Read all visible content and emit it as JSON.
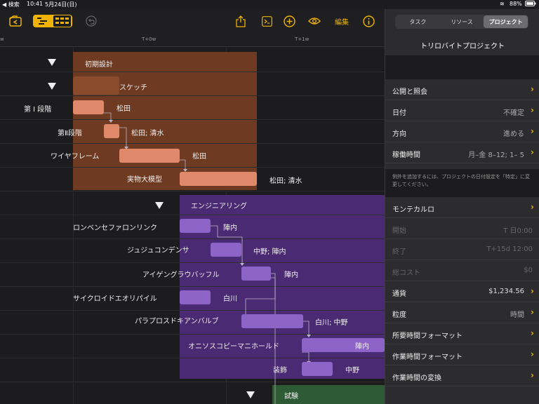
{
  "status": {
    "back_app": "◀ 検索",
    "time": "10:41",
    "date": "5月24日(日)",
    "battery": "88%"
  },
  "toolbar": {
    "edit_label": "編集"
  },
  "timeline": {
    "labels": [
      "w",
      "T+0w",
      "T+1w"
    ]
  },
  "groups": [
    {
      "title": "初期設計",
      "color": "#6e3b22"
    },
    {
      "title": "エンジニアリング",
      "color": "#4a2a72"
    },
    {
      "title": "試験",
      "color": "#2e5a34"
    }
  ],
  "tasks": [
    {
      "label": "スケッチ",
      "assign": ""
    },
    {
      "label": "第 Ⅰ 段階",
      "assign": "松田"
    },
    {
      "label": "第Ⅱ段階",
      "assign": "松田; 清水"
    },
    {
      "label": "ワイヤフレーム",
      "assign": "松田"
    },
    {
      "label": "実物大模型",
      "assign": "松田; 清水"
    },
    {
      "label": "ロンベンセファロンリンク",
      "assign": "陣内"
    },
    {
      "label": "ジュジュコンデンサ",
      "assign": "中野; 陣内"
    },
    {
      "label": "アイゲングラウバッフル",
      "assign": "陣内"
    },
    {
      "label": "サイクロイドエオリパイル",
      "assign": "白川"
    },
    {
      "label": "パラプロスドキアンバルブ",
      "assign": "白川; 中野"
    },
    {
      "label": "オニソスコピーマニホールド",
      "assign": "陣内"
    },
    {
      "label": "装飾",
      "assign": "中野"
    }
  ],
  "colors": {
    "orange_bar": "#e0896a",
    "purple_bar": "#8e63c8",
    "accent": "#f0b400"
  },
  "sidebar": {
    "tabs": [
      "タスク",
      "リソース",
      "プロジェクト"
    ],
    "active_tab": "プロジェクト",
    "project_title": "トリロバイトプロジェクト",
    "rows_a": [
      {
        "key": "公開と照会",
        "value": ""
      },
      {
        "key": "日付",
        "value": "不確定"
      },
      {
        "key": "方向",
        "value": "進める"
      },
      {
        "key": "稼働時間",
        "value": "月–金 8–12; 1– 5"
      }
    ],
    "hint": "例外を追加するには、プロジェクトの日付設定を「特定」に変更してください。",
    "rows_b": [
      {
        "key": "モンテカルロ",
        "value": ""
      },
      {
        "key": "開始",
        "value": "T 日0:00"
      },
      {
        "key": "終了",
        "value": "T+15d 12:00"
      },
      {
        "key": "総コスト",
        "value": "$0"
      },
      {
        "key": "通貨",
        "value": "$1,234.56"
      },
      {
        "key": "粒度",
        "value": "時間"
      },
      {
        "key": "所要時間フォーマット",
        "value": ""
      },
      {
        "key": "作業時間フォーマット",
        "value": ""
      },
      {
        "key": "作業時間の変換",
        "value": ""
      }
    ]
  }
}
